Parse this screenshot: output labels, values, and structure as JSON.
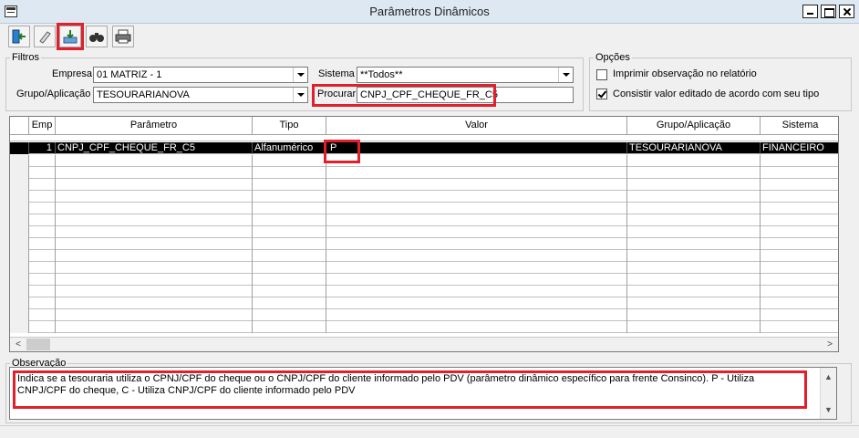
{
  "window": {
    "title": "Parâmetros Dinâmicos"
  },
  "toolbar": {
    "buttons": [
      {
        "name": "exit-icon",
        "glyph": "⇤"
      },
      {
        "name": "eraser-icon",
        "glyph": "✎"
      },
      {
        "name": "export-icon",
        "glyph": "⇩"
      },
      {
        "name": "binoculars-icon",
        "glyph": "⚲"
      },
      {
        "name": "printer-icon",
        "glyph": "⎙"
      }
    ]
  },
  "filtros": {
    "legend": "Filtros",
    "empresa_label": "Empresa",
    "empresa_value": "01 MATRIZ - 1",
    "grupo_label": "Grupo/Aplicação",
    "grupo_value": "TESOURARIANOVA",
    "sistema_label": "Sistema",
    "sistema_value": "**Todos**",
    "procurar_label": "Procurar",
    "procurar_value": "CNPJ_CPF_CHEQUE_FR_C5"
  },
  "opcoes": {
    "legend": "Opções",
    "imprimir_label": "Imprimir observação no relatório",
    "imprimir_checked": false,
    "consistir_label": "Consistir valor editado de acordo com seu tipo",
    "consistir_checked": true
  },
  "grid": {
    "columns": [
      "Emp",
      "Parâmetro",
      "Tipo",
      "Valor",
      "Grupo/Aplicação",
      "Sistema"
    ],
    "rows": [
      {
        "emp": "1",
        "parametro": "CNPJ_CPF_CHEQUE_FR_C5",
        "tipo": "Alfanumérico",
        "valor": "P",
        "grupo": "TESOURARIANOVA",
        "sistema": "FINANCEIRO"
      }
    ]
  },
  "observacao": {
    "legend": "Observação",
    "text": "Indica se a tesouraria utiliza o CPNJ/CPF do cheque ou o CNPJ/CPF do cliente informado pelo PDV (parâmetro dinâmico específico para frente Consinco). P - Utiliza CNPJ/CPF do cheque, C - Utiliza CNPJ/CPF do cliente informado pelo PDV"
  },
  "colors": {
    "highlight": "#e0202a",
    "selected_row": "#000000"
  }
}
